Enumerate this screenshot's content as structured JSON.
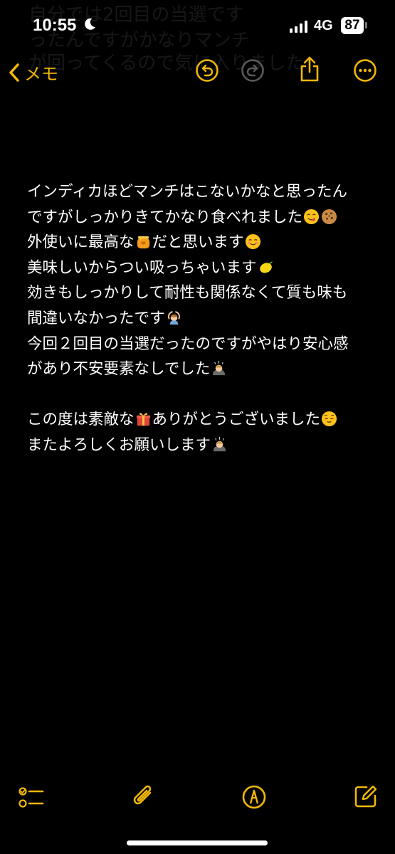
{
  "status_bar": {
    "time": "10:55",
    "network": "4G",
    "battery": "87",
    "icons": [
      "moon-icon",
      "signal-icon",
      "battery-icon"
    ]
  },
  "background_ghost_text": [
    "自分では2回目の当選です",
    "ったんですがかなりマンチ",
    "が回ってくるので気に入りました"
  ],
  "nav": {
    "back_label": "メモ",
    "icons": [
      "chevron-left-icon",
      "undo-icon",
      "redo-icon",
      "share-icon",
      "more-icon"
    ]
  },
  "note": {
    "lines": [
      {
        "text": "インディカほどマンチはこないかなと思ったん",
        "emoji": []
      },
      {
        "text": "ですがしっかりきてかなり食べれました",
        "emoji": [
          "yum-face",
          "cookie"
        ]
      },
      {
        "text": "外使いに最高な",
        "emoji": [
          "honey-pot"
        ],
        "after": "だと思います",
        "emoji2": [
          "smiling-face"
        ]
      },
      {
        "text": "美味しいからつい吸っちゃいます",
        "emoji": [
          "lemon"
        ]
      },
      {
        "text": "効きもしっかりして耐性も関係なくて質も味も",
        "emoji": []
      },
      {
        "text": "間違いなかったです",
        "emoji": [
          "person-gesturing-ok"
        ]
      },
      {
        "text": "今回２回目の当選だったのですがやはり安心感",
        "emoji": []
      },
      {
        "text": "があり不安要素なしでした",
        "emoji": [
          "person-bowing"
        ]
      },
      {
        "text": "",
        "emoji": []
      },
      {
        "text": "この度は素敵な",
        "emoji": [
          "gift"
        ],
        "after": "ありがとうございました",
        "emoji2": [
          "relieved-face"
        ]
      },
      {
        "text": "またよろしくお願いします",
        "emoji": [
          "person-bowing"
        ]
      }
    ]
  },
  "toolbar": {
    "icons": [
      "checklist-icon",
      "paperclip-icon",
      "markup-pen-icon",
      "compose-icon"
    ]
  },
  "colors": {
    "accent": "#f2b807",
    "background": "#000000",
    "text": "#ffffff"
  }
}
